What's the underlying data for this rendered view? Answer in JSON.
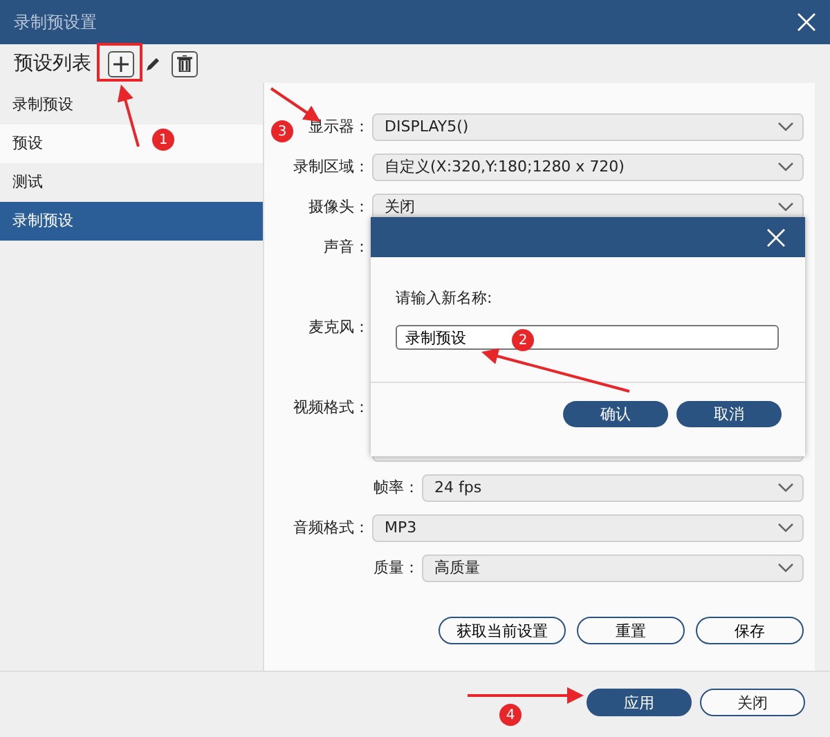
{
  "window": {
    "title": "录制预设置"
  },
  "toolbar": {
    "title": "预设列表"
  },
  "sidebar": {
    "items": [
      {
        "label": "录制预设",
        "selected": false
      },
      {
        "label": "预设",
        "selected": false
      },
      {
        "label": "测试",
        "selected": false
      },
      {
        "label": "录制预设",
        "selected": true
      }
    ]
  },
  "form": {
    "rows": [
      {
        "kind": "main",
        "label": "显示器：",
        "value": "DISPLAY5()"
      },
      {
        "kind": "main",
        "label": "录制区域：",
        "value": "自定义(X:320,Y:180;1280 x 720)"
      },
      {
        "kind": "main",
        "label": "摄像头：",
        "value": "关闭"
      },
      {
        "kind": "label",
        "label": "声音："
      },
      {
        "kind": "gap"
      },
      {
        "kind": "label",
        "label": "麦克风："
      },
      {
        "kind": "gap"
      },
      {
        "kind": "label",
        "label": "视频格式："
      },
      {
        "kind": "edge"
      },
      {
        "kind": "sub",
        "label": "帧率：",
        "value": "24 fps"
      },
      {
        "kind": "main",
        "label": "音频格式：",
        "value": "MP3"
      },
      {
        "kind": "sub",
        "label": "质量：",
        "value": "高质量"
      }
    ],
    "buttons": [
      "获取当前设置",
      "重置",
      "保存"
    ]
  },
  "footer": {
    "buttons": [
      {
        "label": "应用",
        "primary": true
      },
      {
        "label": "关闭",
        "primary": false
      }
    ]
  },
  "dialog": {
    "prompt": "请输入新名称:",
    "value": "录制预设",
    "buttons": [
      {
        "label": "确认"
      },
      {
        "label": "取消"
      }
    ]
  },
  "annotations": [
    {
      "number": "1"
    },
    {
      "number": "2"
    },
    {
      "number": "3"
    },
    {
      "number": "4"
    }
  ]
}
